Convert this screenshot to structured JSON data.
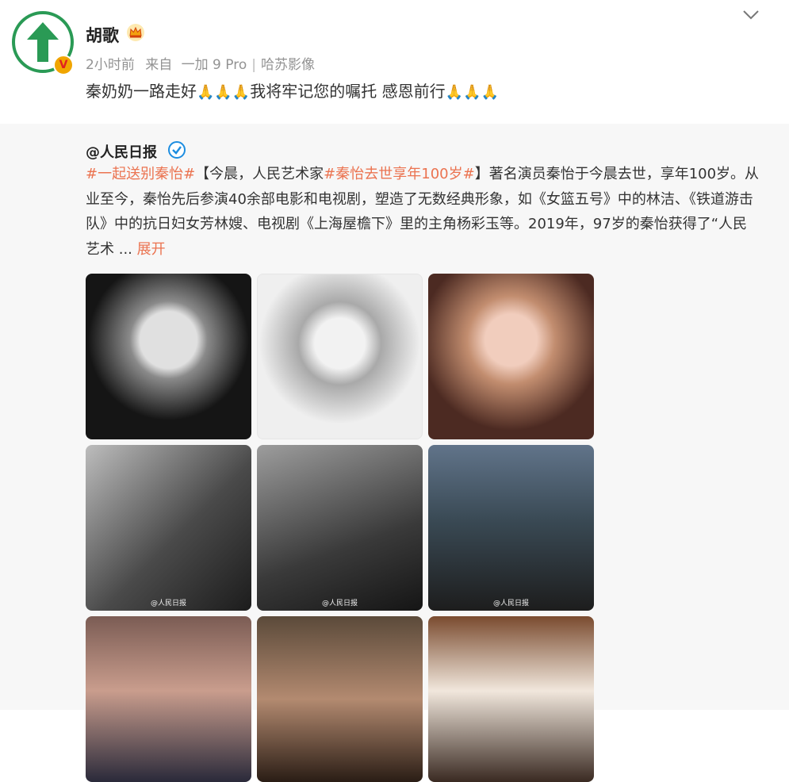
{
  "post": {
    "username": "胡歌",
    "time": "2小时前",
    "source_prefix": "来自",
    "device": "一加 9 Pro",
    "location": "哈苏影像",
    "text_a": "秦奶奶一路走好",
    "text_b": "我将牢记您的嘱托 感恩前行",
    "pray_emoji": "🙏",
    "vip_badge": "V",
    "icons": [
      "crown-icon",
      "chevron-down-icon",
      "verified-icon"
    ]
  },
  "repost": {
    "author": "@人民日报",
    "hashtag1": "#一起送别秦怡#",
    "bracket_open": "【今晨，人民艺术家",
    "hashtag2": "#秦怡去世享年100岁#",
    "text_rest": "】著名演员秦怡于今晨去世，享年100岁。从业至今，秦怡先后参演40余部电影和电视剧，塑造了无数经典形象，如《女篮五号》中的林洁、《铁道游击队》中的抗日妇女芳林嫂、电视剧《上海屋檐下》里的主角杨彩玉等。2019年，97岁的秦怡获得了“人民艺术",
    "ellipsis": " ... ",
    "expand": "展开",
    "watermark": "@人民日报",
    "colors": {
      "link": "#eb7350",
      "background": "#f7f7f7"
    }
  }
}
